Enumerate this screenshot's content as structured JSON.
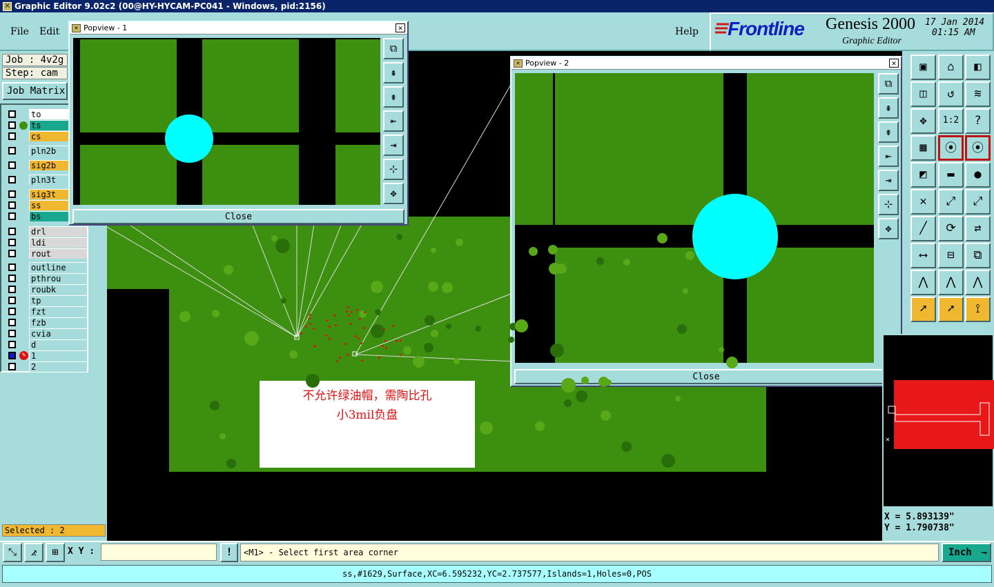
{
  "window": {
    "title": "Graphic Editor 9.02c2 (00@HY-HYCAM-PC041 - Windows, pid:2156)"
  },
  "menu": {
    "file": "File",
    "edit": "Edit",
    "help": "Help"
  },
  "branding": {
    "logo": "Frontline",
    "product": "Genesis 2000",
    "subtitle": "Graphic Editor",
    "date": "17 Jan 2014",
    "time": "01:15 AM"
  },
  "job": {
    "job_label": "Job : 4v2g",
    "step_label": "Step: cam",
    "matrix_button": "Job Matrix"
  },
  "layers": [
    {
      "name": "to",
      "color": "#ffffff"
    },
    {
      "name": "ts",
      "color": "#18a890",
      "active": true
    },
    {
      "name": "cs",
      "color": "#f0b830"
    },
    {
      "name": "pln2b",
      "color": "#a7dcdc"
    },
    {
      "name": "sig2b",
      "color": "#f0b830"
    },
    {
      "name": "pln3t",
      "color": "#a7dcdc"
    },
    {
      "name": "sig3t",
      "color": "#f0b830"
    },
    {
      "name": "ss",
      "color": "#f0b830"
    },
    {
      "name": "bs",
      "color": "#18a890"
    },
    {
      "name": "drl",
      "color": "#d8d8d8"
    },
    {
      "name": "ldi",
      "color": "#d8d8d8"
    },
    {
      "name": "rout",
      "color": "#d8d8d8"
    },
    {
      "name": "outline",
      "color": "#a7dcdc"
    },
    {
      "name": "pthrou",
      "color": "#a7dcdc"
    },
    {
      "name": "roubk",
      "color": "#a7dcdc"
    },
    {
      "name": "tp",
      "color": "#a7dcdc"
    },
    {
      "name": "fzt",
      "color": "#a7dcdc"
    },
    {
      "name": "fzb",
      "color": "#a7dcdc"
    },
    {
      "name": "cvia",
      "color": "#a7dcdc"
    },
    {
      "name": "d",
      "color": "#a7dcdc"
    },
    {
      "name": "1",
      "color": "#a7dcdc",
      "work": true
    },
    {
      "name": "2",
      "color": "#a7dcdc"
    }
  ],
  "selected": "Selected : 2",
  "popview1": {
    "title": "Popview - 1",
    "close": "Close"
  },
  "popview2": {
    "title": "Popview - 2",
    "close": "Close"
  },
  "annotation": {
    "line1": "不允许绿油帽，需陶比孔",
    "line2": "小3mil负盘"
  },
  "coords": {
    "x": "X = 5.893139\"",
    "y": "Y = 1.790738\""
  },
  "status": {
    "xy_label": "X Y :",
    "xy_value": "",
    "prompt": "<M1> - Select first area corner",
    "units": "Inch"
  },
  "info": "ss,#1629,Surface,XC=6.595232,YC=2.737577,Islands=1,Holes=0,POS",
  "colors": {
    "panel": "#a7dcdc",
    "board": "#3d8f10",
    "pad": "#00ffff",
    "select": "#f0b830"
  }
}
